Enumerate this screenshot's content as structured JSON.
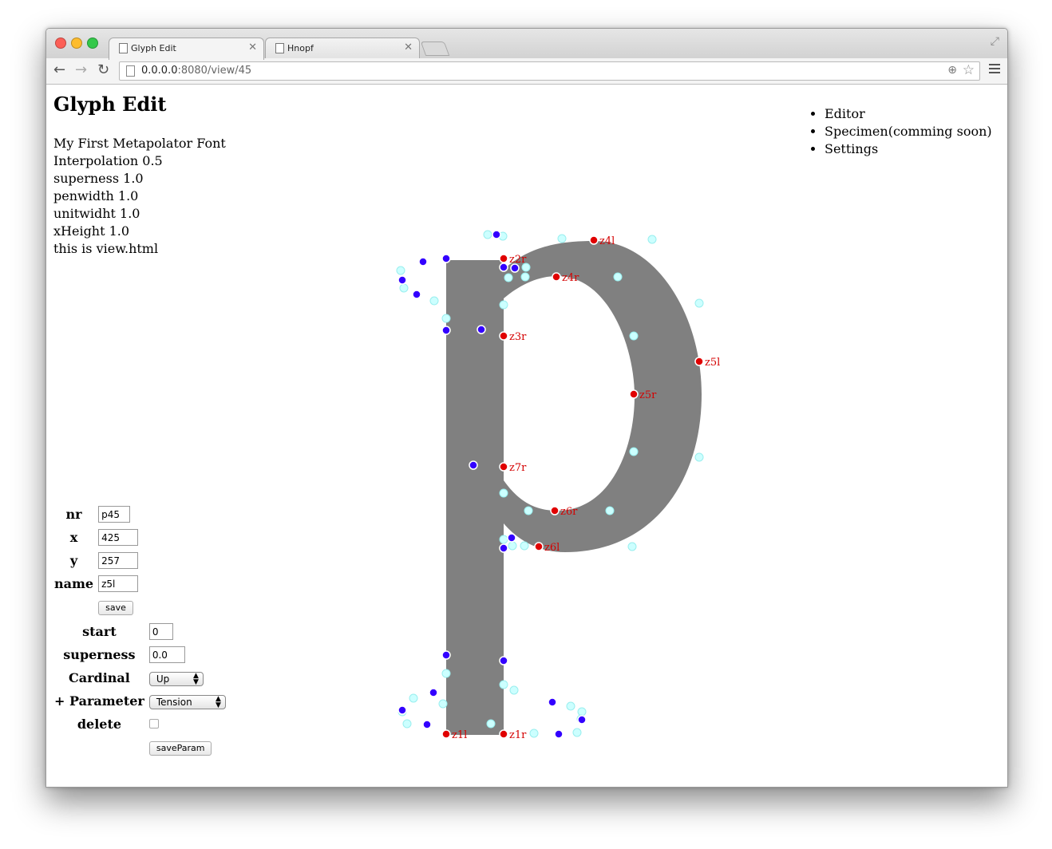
{
  "browser": {
    "tabs": [
      {
        "title": "Glyph Edit",
        "active": true
      },
      {
        "title": "Hnopf",
        "active": false
      }
    ],
    "url_host": "0.0.0.0",
    "url_rest": ":8080/view/45"
  },
  "page": {
    "title": "Glyph Edit",
    "info_lines": [
      "My First Metapolator Font",
      "Interpolation 0.5",
      "superness 1.0",
      "penwidth 1.0",
      "unitwidht 1.0",
      "xHeight 1.0",
      "this is view.html"
    ],
    "nav": [
      "Editor",
      "Specimen(comming soon)",
      "Settings"
    ]
  },
  "point_form": {
    "nr_label": "nr",
    "nr_value": "p45",
    "x_label": "x",
    "x_value": "425",
    "y_label": "y",
    "y_value": "257",
    "name_label": "name",
    "name_value": "z5l",
    "save_label": "save"
  },
  "param_form": {
    "start_label": "start",
    "start_value": "0",
    "superness_label": "superness",
    "superness_value": "0.0",
    "cardinal_label": "Cardinal",
    "cardinal_value": "Up",
    "parameter_label": "+ Parameter",
    "parameter_value": "Tension",
    "delete_label": "delete",
    "save_label": "saveParam"
  },
  "glyph": {
    "fill_color": "#808080",
    "point_colors": {
      "labeled": "#e00000",
      "control": "#3300ff",
      "handle": "#ccffff"
    },
    "labels": [
      "z1l",
      "z1r",
      "z2r",
      "z3r",
      "z4l",
      "z4r",
      "z5l",
      "z5r",
      "z6l",
      "z6r",
      "z7r"
    ]
  }
}
